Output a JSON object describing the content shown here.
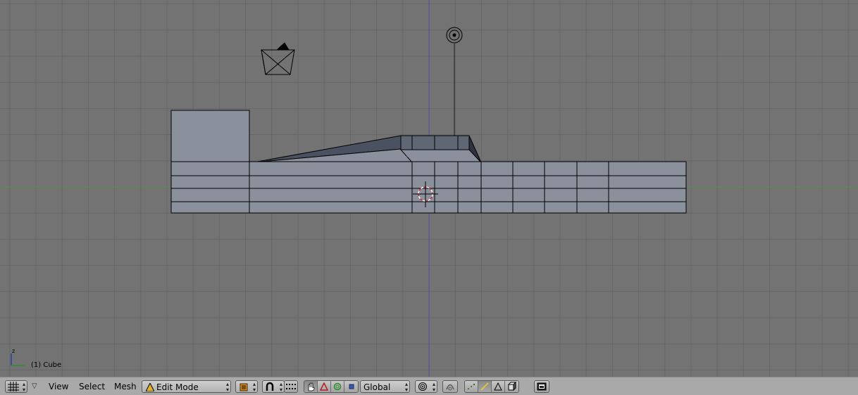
{
  "viewport": {
    "object_label": "(1) Cube",
    "axis_label": "z"
  },
  "toolbar": {
    "menus": [
      "View",
      "Select",
      "Mesh"
    ],
    "mode": "Edit Mode",
    "orientation": "Global"
  },
  "icons": {
    "editor_type": "grid-icon",
    "collapse": "triangle-down-icon",
    "draw_type": "cube-draw-type-icon",
    "snap": "magnet-icon",
    "manipulator": "hand-icon",
    "manip_translate": "translate-icon",
    "manip_rotate": "rotate-icon",
    "manip_scale": "scale-icon",
    "pivot": "pivot-icon",
    "proportional": "proportional-edit-icon",
    "select_vertex": "vertex-select-icon",
    "select_edge": "edge-select-icon",
    "select_face": "face-select-icon",
    "occlude": "occlude-geometry-icon",
    "render": "render-icon"
  },
  "colors": {
    "viewport_bg": "#737373",
    "grid_line": "#666666",
    "x_axis": "#5a8c4a",
    "z_axis": "#5a4a9c",
    "mesh_face": "#8a919c",
    "mesh_dark": "#4a5160",
    "toolbar_bg": "#a9a9a9"
  }
}
